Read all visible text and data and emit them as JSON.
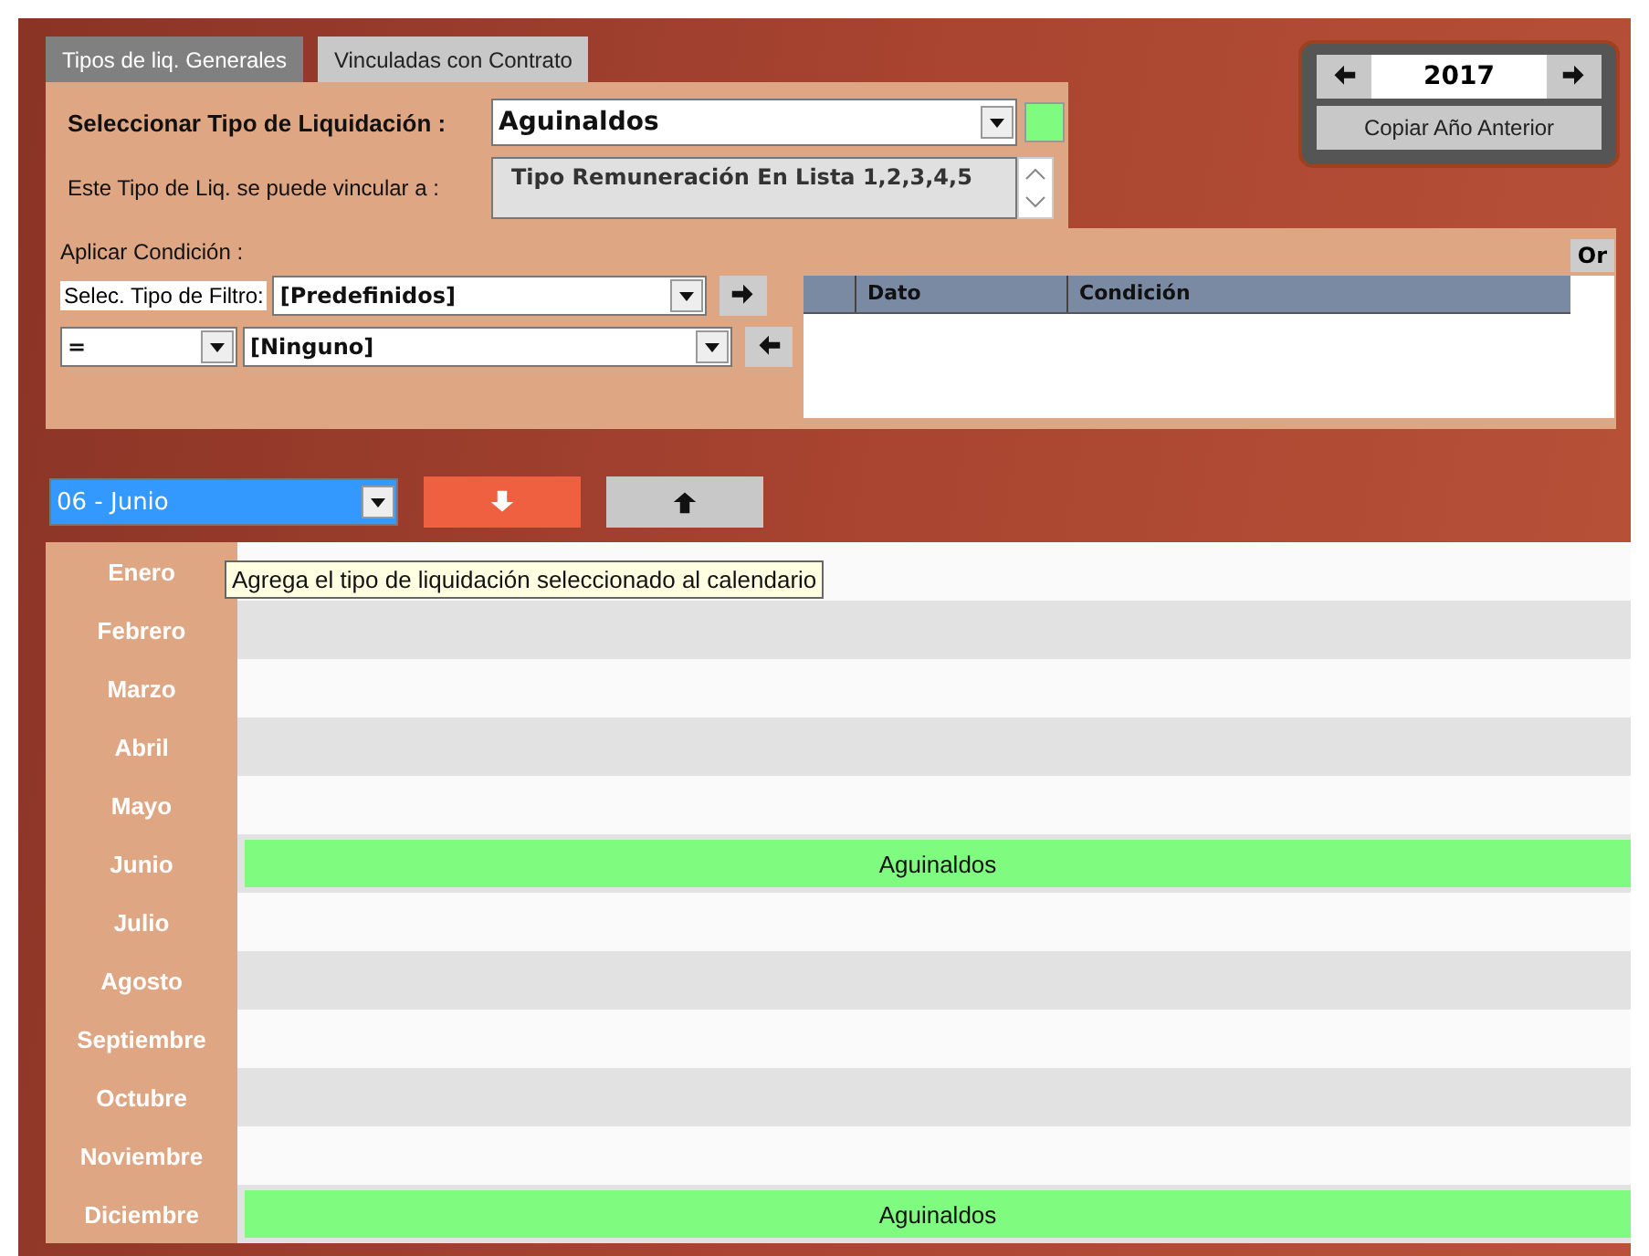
{
  "tabs": [
    {
      "label": "Tipos de liq. Generales",
      "selected": true
    },
    {
      "label": "Vinculadas con Contrato",
      "selected": false
    }
  ],
  "liquidacion": {
    "label": "Seleccionar Tipo de Liquidación :",
    "value": "Aguinaldos"
  },
  "vinculo": {
    "label": "Este Tipo de Liq. se puede vincular a :",
    "value": "Tipo Remuneración En Lista 1,2,3,4,5"
  },
  "condicion": {
    "label": "Aplicar Condición :",
    "filter_label": "Selec. Tipo de Filtro:",
    "filter_value": "[Predefinidos]",
    "operator_value": "=",
    "value_select": "[Ninguno]",
    "columns": [
      "Dato",
      "Condición"
    ],
    "or_label": "Or"
  },
  "year": {
    "value": "2017",
    "copy_button": "Copiar Año Anterior"
  },
  "month_select": {
    "value": "06 - Junio"
  },
  "tooltip": "Agrega el tipo de liquidación seleccionado al calendario",
  "calendar": [
    {
      "month": "Enero"
    },
    {
      "month": "Febrero"
    },
    {
      "month": "Marzo"
    },
    {
      "month": "Abril"
    },
    {
      "month": "Mayo"
    },
    {
      "month": "Junio",
      "entry": "Aguinaldos"
    },
    {
      "month": "Julio"
    },
    {
      "month": "Agosto"
    },
    {
      "month": "Septiembre"
    },
    {
      "month": "Octubre"
    },
    {
      "month": "Noviembre"
    },
    {
      "month": "Diciembre",
      "entry": "Aguinaldos"
    }
  ]
}
